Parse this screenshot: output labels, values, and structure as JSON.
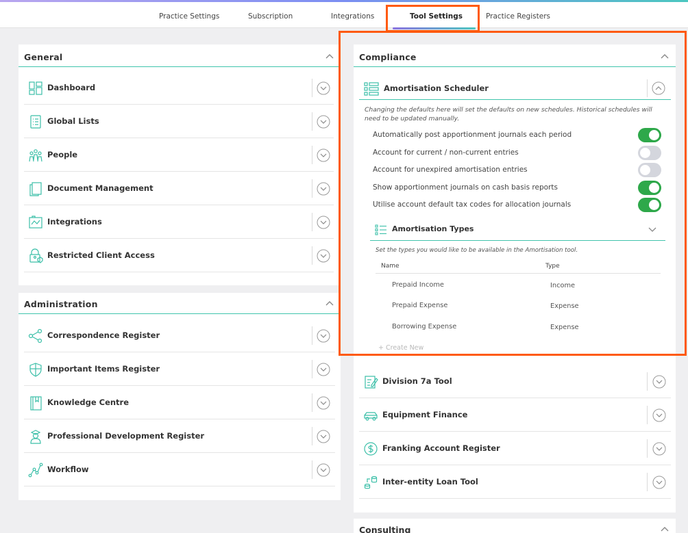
{
  "nav": {
    "tabs": [
      "Practice Settings",
      "Subscription",
      "Integrations",
      "Tool Settings",
      "Practice Registers"
    ],
    "active": "Tool Settings"
  },
  "general": {
    "title": "General",
    "items": [
      "Dashboard",
      "Global Lists",
      "People",
      "Document Management",
      "Integrations",
      "Restricted Client Access"
    ]
  },
  "administration": {
    "title": "Administration",
    "items": [
      "Correspondence Register",
      "Important Items Register",
      "Knowledge Centre",
      "Professional Development Register",
      "Workflow"
    ]
  },
  "compliance": {
    "title": "Compliance",
    "amortisation": {
      "title": "Amortisation Scheduler",
      "description": "Changing the defaults here will set the defaults on new schedules. Historical schedules will need to be updated manually.",
      "toggles": [
        {
          "label": "Automatically post apportionment journals each period",
          "state": "on"
        },
        {
          "label": "Account for current / non-current entries",
          "state": "off"
        },
        {
          "label": "Account for unexpired amortisation entries",
          "state": "off"
        },
        {
          "label": "Show apportionment journals on cash basis reports",
          "state": "on"
        },
        {
          "label": "Utilise account default tax codes for allocation journals",
          "state": "on"
        }
      ],
      "types": {
        "title": "Amortisation Types",
        "description": "Set the types you would like to be available in the Amortisation tool.",
        "col_name": "Name",
        "col_type": "Type",
        "rows": [
          {
            "name": "Prepaid Income",
            "type": "Income"
          },
          {
            "name": "Prepaid Expense",
            "type": "Expense"
          },
          {
            "name": "Borrowing Expense",
            "type": "Expense"
          }
        ],
        "create_label": "Create New"
      }
    },
    "items": [
      "Division 7a Tool",
      "Equipment Finance",
      "Franking Account Register",
      "Inter-entity Loan Tool"
    ]
  },
  "consulting": {
    "title": "Consulting"
  },
  "colors": {
    "accent": "#40c4ac",
    "toggle_on": "#2ea84a",
    "highlight": "#ff5a0d"
  }
}
